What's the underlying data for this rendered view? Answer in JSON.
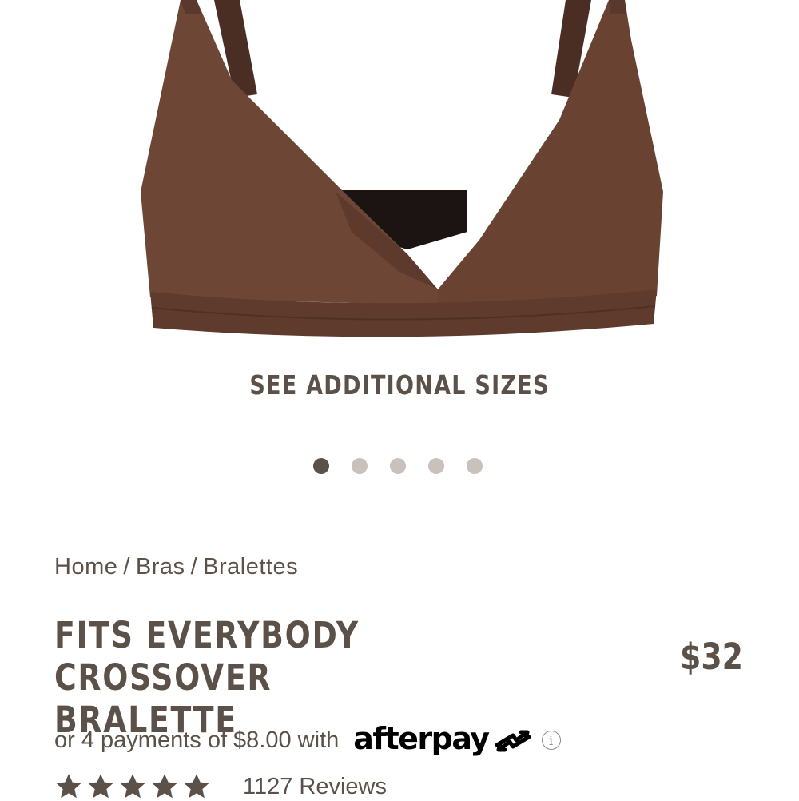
{
  "product": {
    "image": {
      "icon": "brown-crossover-bralette-photo",
      "color": "#6e4636"
    },
    "additional_sizes_label": "SEE ADDITIONAL SIZES",
    "carousel": {
      "count": 5,
      "active_index": 0
    },
    "breadcrumb": [
      "Home",
      "Bras",
      "Bralettes"
    ],
    "breadcrumb_separator": "/",
    "title_line1": "FITS EVERYBODY CROSSOVER",
    "title_line2": "BRALETTE",
    "price": "$32",
    "installments_text": "or 4 payments of $8.00 with",
    "afterpay_label": "afterpay",
    "info_icon": "i",
    "rating": {
      "stars": 5,
      "reviews_label": "1127 Reviews"
    }
  },
  "colors": {
    "text": "#5b5148",
    "dot_active": "#5b5148",
    "dot_inactive": "#c9c1bb",
    "afterpay": "#000000"
  }
}
